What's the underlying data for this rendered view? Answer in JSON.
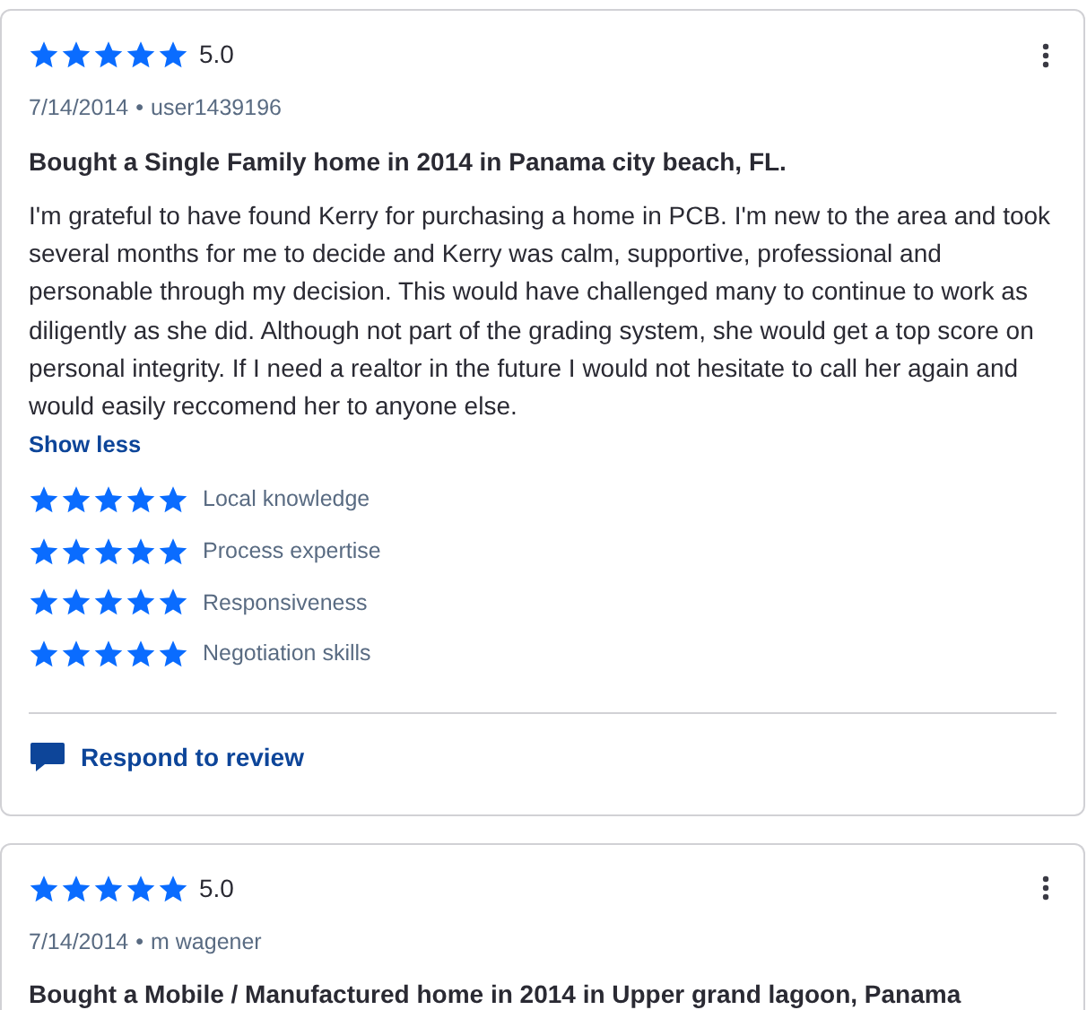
{
  "reviews": [
    {
      "stars": 5,
      "score": "5.0",
      "date": "7/14/2014",
      "separator": "•",
      "author": "user1439196",
      "title": "Bought a Single Family home in 2014 in Panama city beach, FL.",
      "body": "I'm grateful to have found Kerry for purchasing a home in PCB. I'm new to the area and took several months for me to decide and Kerry was calm, supportive, professional and personable through my decision. This would have challenged many to continue to work as diligently as she did. Although not part of the grading system, she would get a top score on personal integrity. If I need a realtor in the future I would not hesitate to call her again and would easily reccomend her to anyone else.",
      "toggle": "Show less",
      "ratings": [
        {
          "stars": 5,
          "label": "Local knowledge"
        },
        {
          "stars": 5,
          "label": "Process expertise"
        },
        {
          "stars": 5,
          "label": "Responsiveness"
        },
        {
          "stars": 5,
          "label": "Negotiation skills"
        }
      ],
      "respond": "Respond to review"
    },
    {
      "stars": 5,
      "score": "5.0",
      "date": "7/14/2014",
      "separator": "•",
      "author": "m wagener",
      "title": "Bought a Mobile / Manufactured home in 2014 in Upper grand lagoon, Panama"
    }
  ]
}
